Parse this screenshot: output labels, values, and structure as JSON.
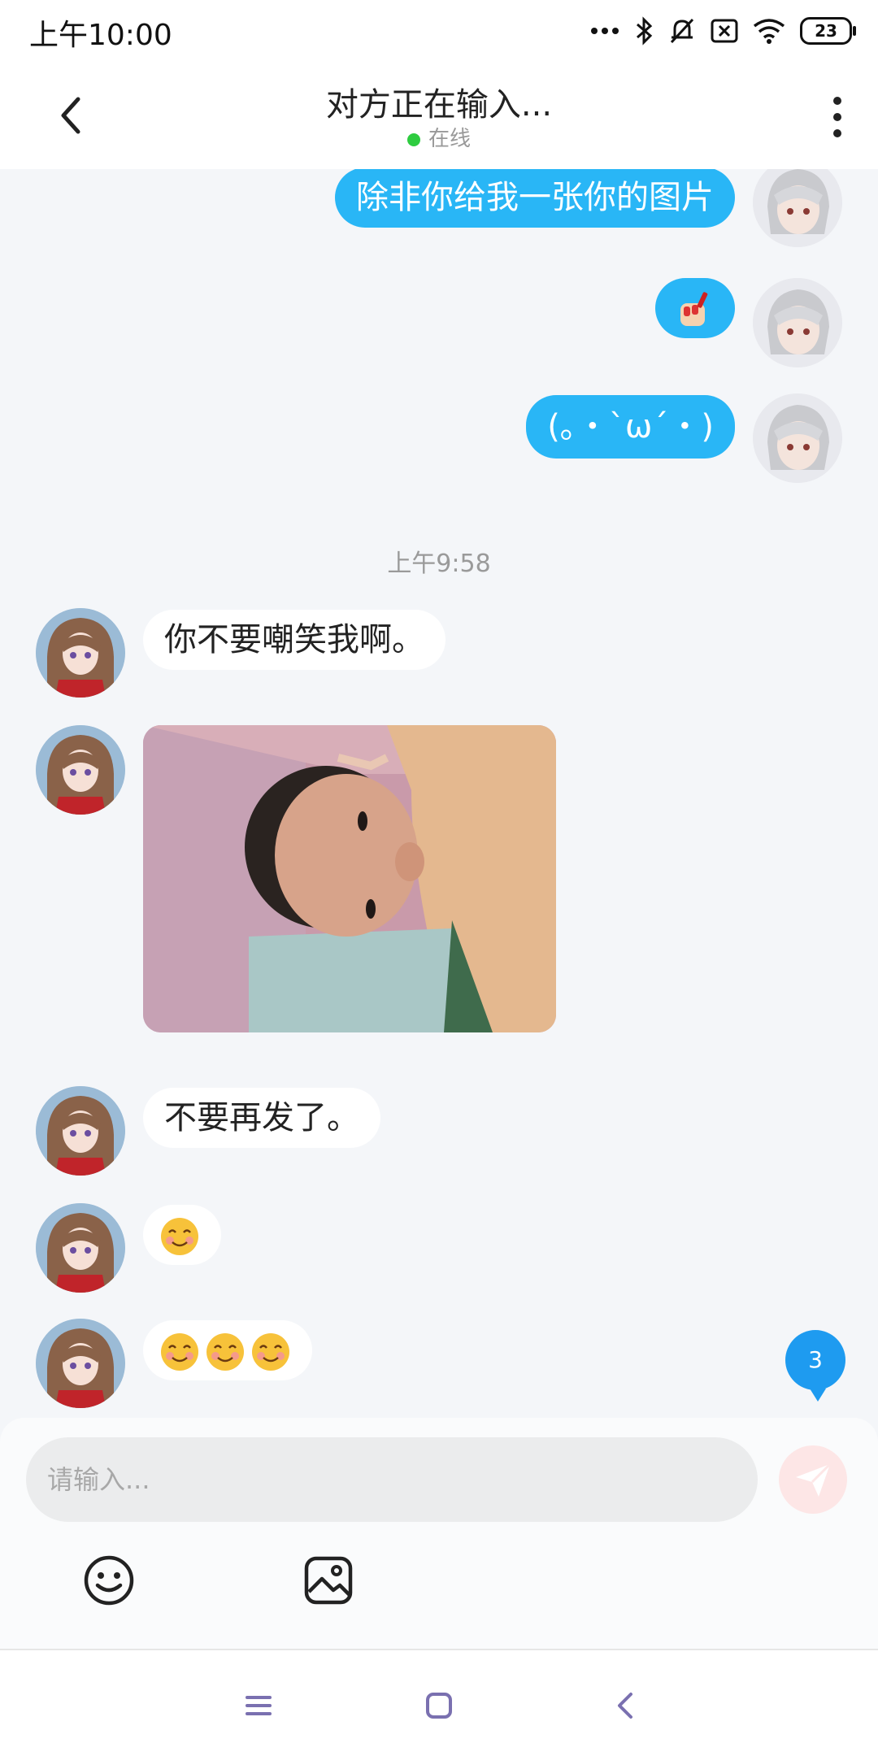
{
  "status_bar": {
    "time": "上午10:00",
    "battery": "23",
    "icons": [
      "more-dots-icon",
      "bluetooth-icon",
      "mute-bell-icon",
      "sim-x-icon",
      "wifi-icon",
      "battery-icon"
    ]
  },
  "header": {
    "title": "对方正在输入...",
    "status": "在线",
    "status_color": "#2ecc40"
  },
  "messages": [
    {
      "side": "out",
      "type": "text",
      "text": "除非你给我一张你的图片"
    },
    {
      "side": "out",
      "type": "emoji",
      "text": "💅"
    },
    {
      "side": "out",
      "type": "text",
      "text": "(｡・`ω´・)"
    },
    {
      "type": "timestamp",
      "text": "上午9:58"
    },
    {
      "side": "in",
      "type": "text",
      "text": "你不要嘲笑我啊。"
    },
    {
      "side": "in",
      "type": "image",
      "description": "photo"
    },
    {
      "side": "in",
      "type": "text",
      "text": "不要再发了。"
    },
    {
      "side": "in",
      "type": "emoji",
      "text": "😊"
    },
    {
      "side": "in",
      "type": "emoji",
      "text": "😊😊😊"
    }
  ],
  "unread_count": "3",
  "input": {
    "placeholder": "请输入..."
  },
  "colors": {
    "outgoing_bubble": "#29b6f6",
    "incoming_bubble": "#ffffff",
    "background": "#f4f6f9",
    "badge": "#1e9bf0"
  }
}
